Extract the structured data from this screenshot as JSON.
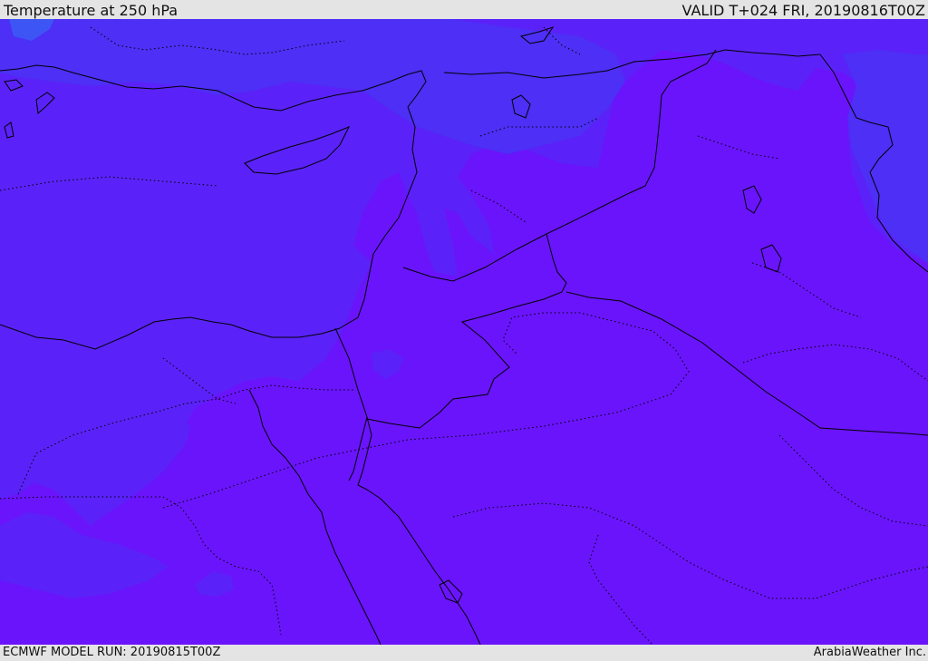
{
  "header": {
    "title": "Temperature at 250 hPa",
    "valid_time": "VALID T+024 FRI, 20190816T00Z"
  },
  "footer": {
    "model_run": "ECMWF MODEL RUN: 20190815T00Z",
    "credit": "ArabiaWeather Inc."
  },
  "colors": {
    "field_warm": "#6a14fb",
    "field_mid": "#5a22f8",
    "field_cool": "#4d2ff5",
    "field_coldest": "#3d55f5",
    "border_line": "#000000",
    "frame": "#e4e4e4"
  }
}
